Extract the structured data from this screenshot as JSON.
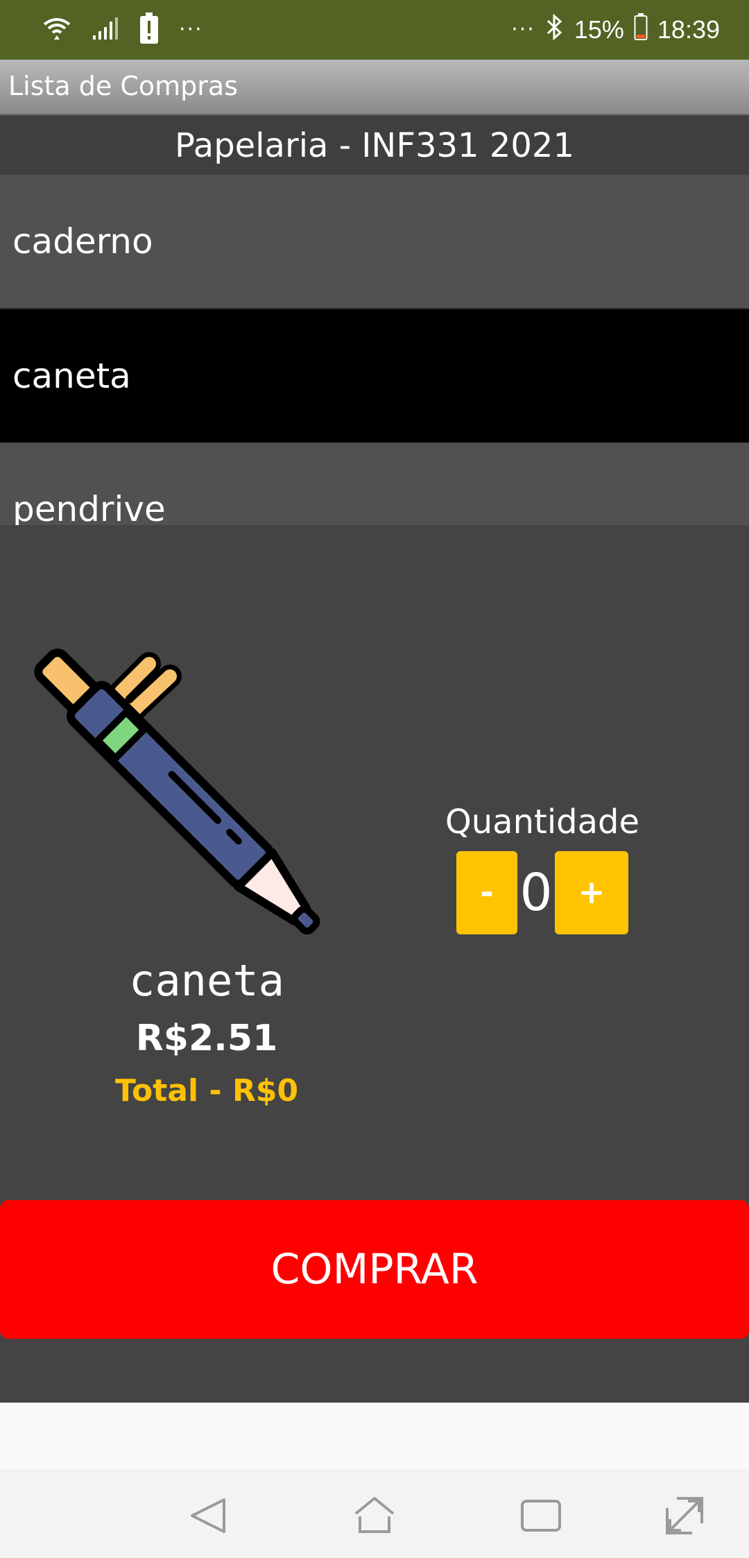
{
  "status_bar": {
    "battery": "15%",
    "time": "18:39",
    "dots_left": "···",
    "dots_right": "···",
    "icons": [
      "wifi-icon",
      "signal-icon",
      "battery-alert-icon",
      "bluetooth-icon",
      "battery-icon"
    ]
  },
  "app_bar": {
    "title": "Lista de Compras"
  },
  "list_header": "Papelaria - INF331 2021",
  "items": [
    {
      "label": "caderno",
      "selected": false
    },
    {
      "label": "caneta",
      "selected": true
    },
    {
      "label": "pendrive",
      "selected": false
    }
  ],
  "product": {
    "name": "caneta",
    "price": "R$2.51",
    "total": "Total - R$0",
    "image_icon": "pen-icon"
  },
  "quantity": {
    "label": "Quantidade",
    "minus": "-",
    "value": "0",
    "plus": "+"
  },
  "buy_button": "COMPRAR",
  "nav": [
    "back-icon",
    "home-icon",
    "recents-icon",
    "expand-icon"
  ],
  "colors": {
    "status_bar": "#536323",
    "accent": "#ffc400",
    "total_text": "#ffc107",
    "buy_button": "#ff0000",
    "selected_item": "#000000",
    "panel": "#444444"
  }
}
